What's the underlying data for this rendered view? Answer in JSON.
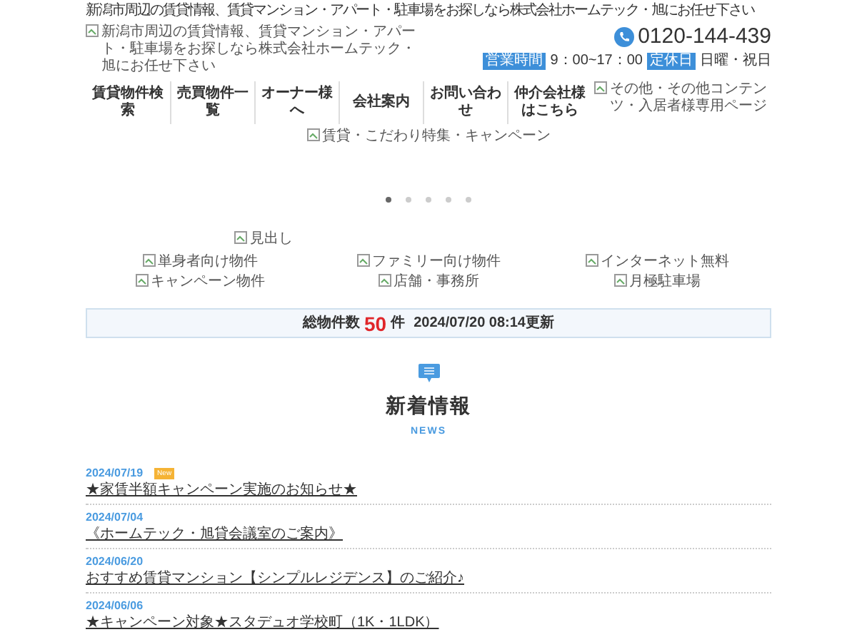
{
  "tagline": "新潟市周辺の賃貸情報、賃貸マンション・アパート・駐車場をお探しなら株式会社ホームテック・旭にお任せ下さい",
  "logo_alt": "新潟市周辺の賃貸情報、賃貸マンション・アパート・駐車場をお探しなら株式会社ホームテック・旭にお任せ下さい",
  "phone": "0120-144-439",
  "hours": [
    {
      "badge": "営業時間",
      "text": "9：00~17：00"
    },
    {
      "badge": "定休日",
      "text": "日曜・祝日"
    }
  ],
  "nav": [
    "賃貸物件検索",
    "売買物件一覧",
    "オーナー様へ",
    "会社案内",
    "お問い合わせ",
    "仲介会社様はこちら"
  ],
  "nav_side_alt": "その他・その他コンテンツ・入居者様専用ページ",
  "banner_alt": "賃貸・こだわり特集・キャンペーン",
  "slider_dots": [
    {
      "selected": true
    },
    {
      "selected": false
    },
    {
      "selected": false
    },
    {
      "selected": false
    },
    {
      "selected": false
    }
  ],
  "heading_alt": "見出し",
  "categories": [
    "単身者向け物件",
    "ファミリー向け物件",
    "インターネット無料",
    "キャンペーン物件",
    "店舗・事務所",
    "月極駐車場"
  ],
  "count": {
    "label": "総物件数",
    "number": "50",
    "unit": "件",
    "updated": "2024/07/20 08:14更新"
  },
  "news": {
    "title": "新着情報",
    "subtitle": "NEWS",
    "items": [
      {
        "date": "2024/07/19",
        "badge": "New",
        "text": "★家賃半額キャンペーン実施のお知らせ★"
      },
      {
        "date": "2024/07/04",
        "text": "《ホームテック・旭貸会議室のご案内》"
      },
      {
        "date": "2024/06/20",
        "text": "おすすめ賃貸マンション【シンプルレジデンス】のご紹介♪"
      },
      {
        "date": "2024/06/06",
        "text": "★キャンペーン対象★スタデュオ学校町（1K・1LDK）"
      }
    ]
  }
}
